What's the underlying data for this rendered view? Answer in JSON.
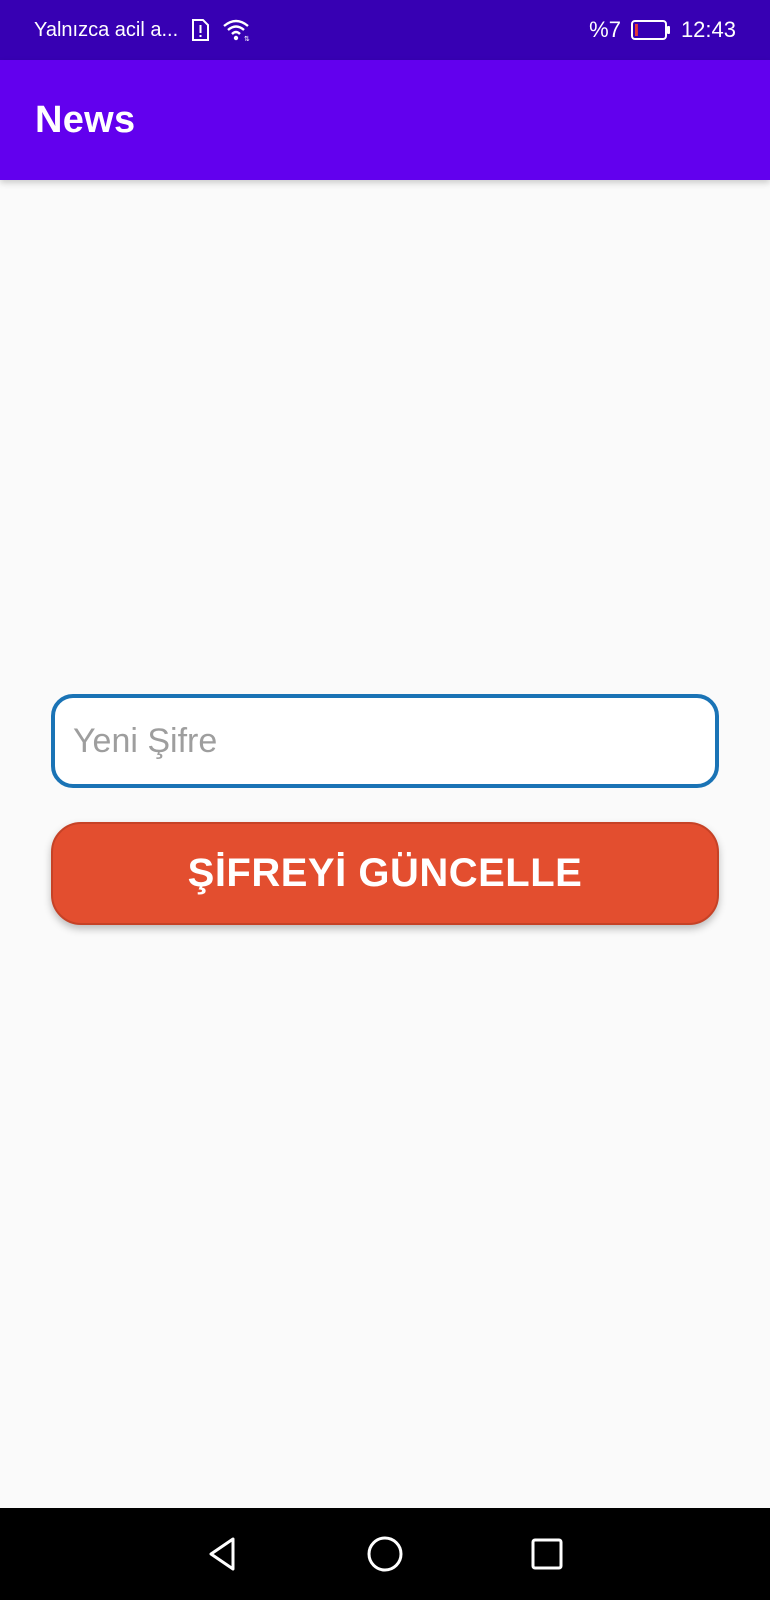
{
  "status_bar": {
    "carrier": "Yalnızca acil a...",
    "battery_percent": "%7",
    "battery_level": 0.07,
    "time": "12:43",
    "icons": [
      "sim-alert-icon",
      "wifi-icon",
      "battery-icon"
    ]
  },
  "app_bar": {
    "title": "News"
  },
  "form": {
    "password_placeholder": "Yeni Şifre",
    "password_value": "",
    "update_button_label": "ŞİFREYİ GÜNCELLE"
  },
  "navigation": {
    "buttons": [
      "back-icon",
      "home-icon",
      "recents-icon"
    ]
  },
  "colors": {
    "status_bar": "#3700b3",
    "app_bar": "#6200ee",
    "input_border": "#1a73b5",
    "button": "#e34e2f"
  }
}
